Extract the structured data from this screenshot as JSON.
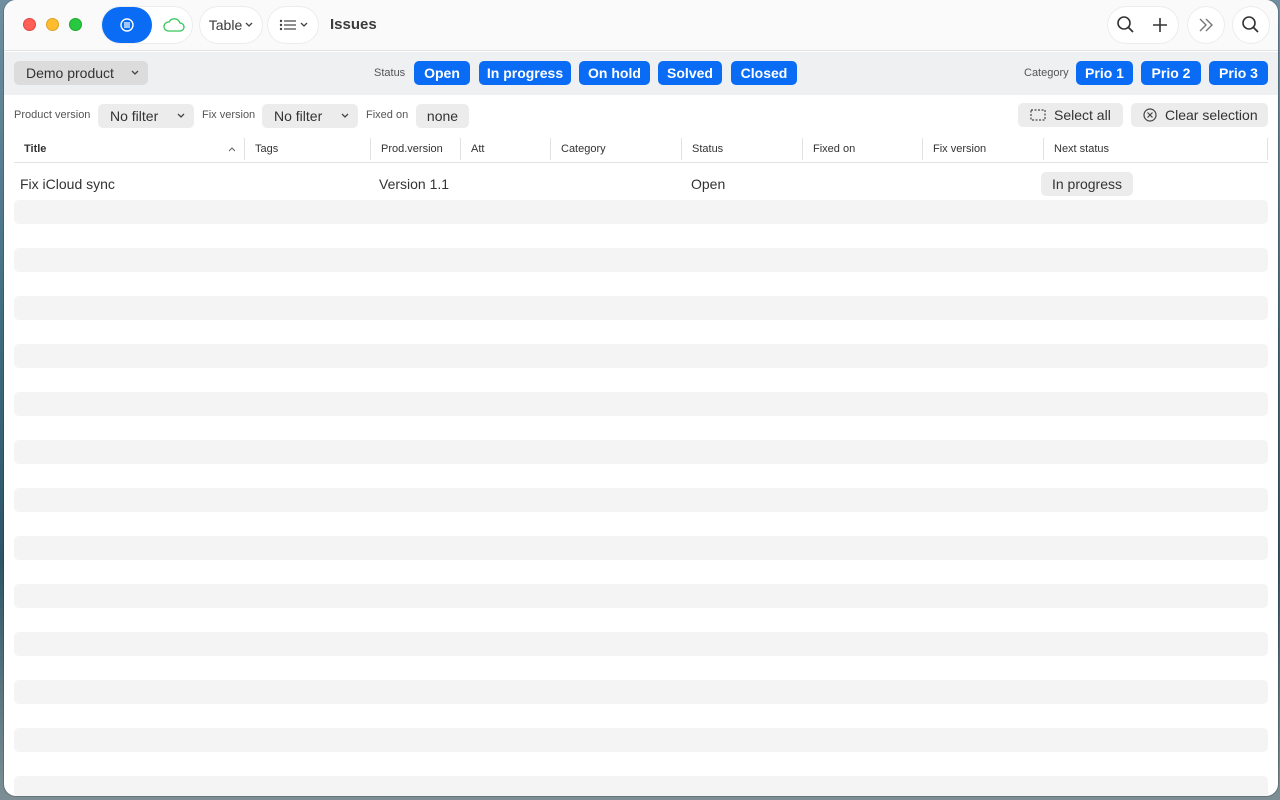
{
  "window": {
    "title": "Issues"
  },
  "toolbar": {
    "view_mode": "Table",
    "icons": [
      "list-icon",
      "cloud-icon",
      "columns-icon",
      "search-icon",
      "plus-icon",
      "chevrons-right-icon",
      "search-icon"
    ]
  },
  "filterbar": {
    "product": "Demo product",
    "status_label": "Status",
    "statuses": [
      "Open",
      "In progress",
      "On hold",
      "Solved",
      "Closed"
    ],
    "category_label": "Category",
    "categories": [
      "Prio 1",
      "Prio 2",
      "Prio 3"
    ]
  },
  "filters": {
    "product_version_label": "Product version",
    "product_version_value": "No filter",
    "fix_version_label": "Fix version",
    "fix_version_value": "No filter",
    "fixed_on_label": "Fixed on",
    "fixed_on_value": "none",
    "select_all": "Select all",
    "clear_selection": "Clear selection"
  },
  "table": {
    "columns": [
      "Title",
      "Tags",
      "Prod.version",
      "Att",
      "Category",
      "Status",
      "Fixed on",
      "Fix version",
      "Next status"
    ],
    "rows": [
      {
        "title": "Fix iCloud sync",
        "tags": "",
        "prod_version": "Version 1.1",
        "att": "",
        "category": "",
        "status": "Open",
        "fixed_on": "",
        "fix_version": "",
        "next_status": "In progress"
      }
    ]
  },
  "colors": {
    "accent": "#0a6cf5",
    "cloud": "#34c759"
  }
}
